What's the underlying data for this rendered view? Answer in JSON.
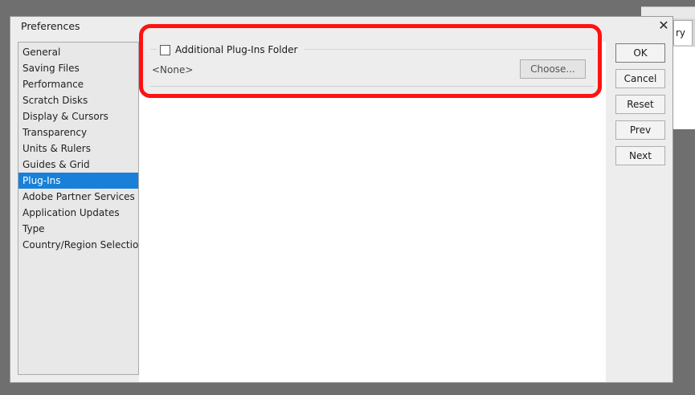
{
  "background_window": {
    "tab_label": "ry"
  },
  "dialog": {
    "title": "Preferences",
    "close_symbol": "✕"
  },
  "sidebar": {
    "items": [
      {
        "label": "General"
      },
      {
        "label": "Saving Files"
      },
      {
        "label": "Performance"
      },
      {
        "label": "Scratch Disks"
      },
      {
        "label": "Display & Cursors"
      },
      {
        "label": "Transparency"
      },
      {
        "label": "Units & Rulers"
      },
      {
        "label": "Guides & Grid"
      },
      {
        "label": "Plug-Ins"
      },
      {
        "label": "Adobe Partner Services"
      },
      {
        "label": "Application Updates"
      },
      {
        "label": "Type"
      },
      {
        "label": "Country/Region Selection"
      }
    ],
    "selected_index": 8
  },
  "plugins": {
    "checkbox_label": "Additional Plug-Ins Folder",
    "checkbox_checked": false,
    "folder_value": "<None>",
    "choose_label": "Choose..."
  },
  "buttons": {
    "ok": "OK",
    "cancel": "Cancel",
    "reset": "Reset",
    "prev": "Prev",
    "next": "Next"
  },
  "colors": {
    "highlight_annotation": "#ff1212",
    "selection": "#1880d8"
  }
}
